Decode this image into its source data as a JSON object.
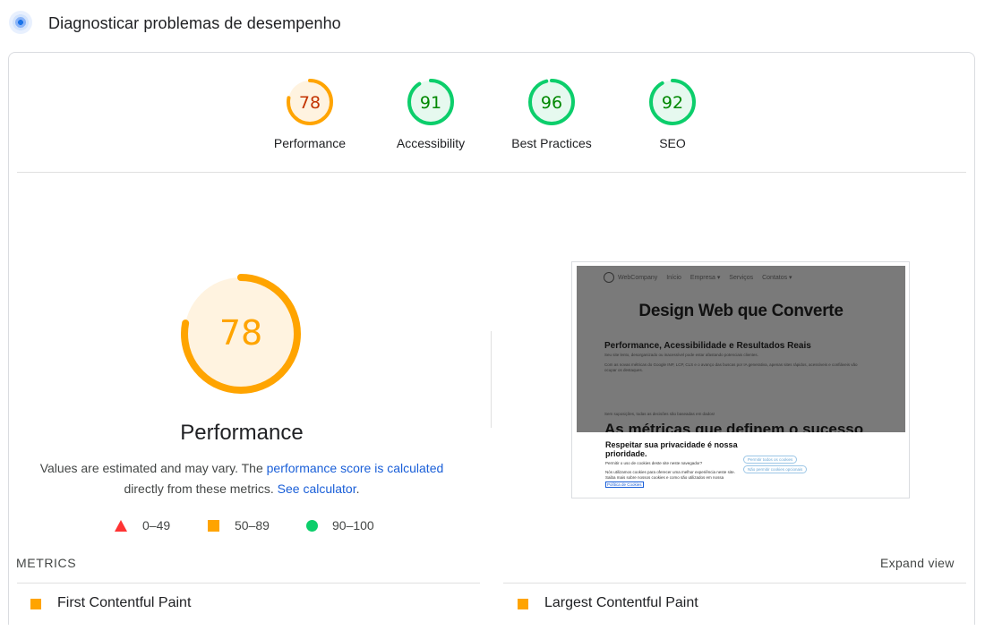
{
  "header": {
    "title": "Diagnosticar problemas de desempenho",
    "icon": "lighthouse-icon"
  },
  "categories": [
    {
      "label": "Performance",
      "score": 78,
      "color": "#ffa400",
      "text_color": "#c33300",
      "bg": "#fff3e0"
    },
    {
      "label": "Accessibility",
      "score": 91,
      "color": "#0cce6b",
      "text_color": "#008800",
      "bg": "#e6f9ef"
    },
    {
      "label": "Best Practices",
      "score": 96,
      "color": "#0cce6b",
      "text_color": "#008800",
      "bg": "#e6f9ef"
    },
    {
      "label": "SEO",
      "score": 92,
      "color": "#0cce6b",
      "text_color": "#008800",
      "bg": "#e6f9ef"
    }
  ],
  "performance": {
    "score": 78,
    "title": "Performance",
    "desc_1": "Values are estimated and may vary. The ",
    "link_1": "performance score is calculated",
    "desc_2": "directly from these metrics. ",
    "link_2": "See calculator",
    "desc_3": "."
  },
  "legend": [
    {
      "shape": "triangle",
      "label": "0–49",
      "color": "#ff3333"
    },
    {
      "shape": "square",
      "label": "50–89",
      "color": "#ffa400"
    },
    {
      "shape": "circle",
      "label": "90–100",
      "color": "#0cce6b"
    }
  ],
  "screenshot": {
    "nav": [
      "Início",
      "Empresa ▾",
      "Serviços",
      "Contatos ▾"
    ],
    "brand": "WebCompany",
    "h1": "Design Web que Converte",
    "h2": "Performance, Acessibilidade e Resultados Reais",
    "p1": "Seu site lento, desorganizado ou inacessível pode estar afastando potenciais clientes.",
    "p2": "Com as novas métricas do Google INP, LCP, CLS e o avanço das buscas por IA generativa, apenas sites rápidos, acessíveis e confiáveis vão",
    "p3": "ocupar os destaques.",
    "p4": "Sem suposições, todas as decisões são baseadas em dados!",
    "h3": "As métricas que definem o sucesso",
    "cookie_title": "Respeitar sua privacidade é nossa prioridade.",
    "cookie_sub": "Permitir o uso de cookies deste site neste navegador?",
    "cookie_text": "Nós utilizamos cookies para oferecer uma melhor experiência neste site. Saiba mais sobre nossos cookies e como são utilizados em nossa",
    "cookie_link": "Política de Cookies",
    "cookie_btn_allow": "Permitir todos os cookies",
    "cookie_btn_deny": "Não permitir cookies opcionais"
  },
  "metrics": {
    "label": "METRICS",
    "expand": "Expand view",
    "items": [
      {
        "label": "First Contentful Paint",
        "color": "#ffa400"
      },
      {
        "label": "Largest Contentful Paint",
        "color": "#ffa400"
      }
    ]
  }
}
